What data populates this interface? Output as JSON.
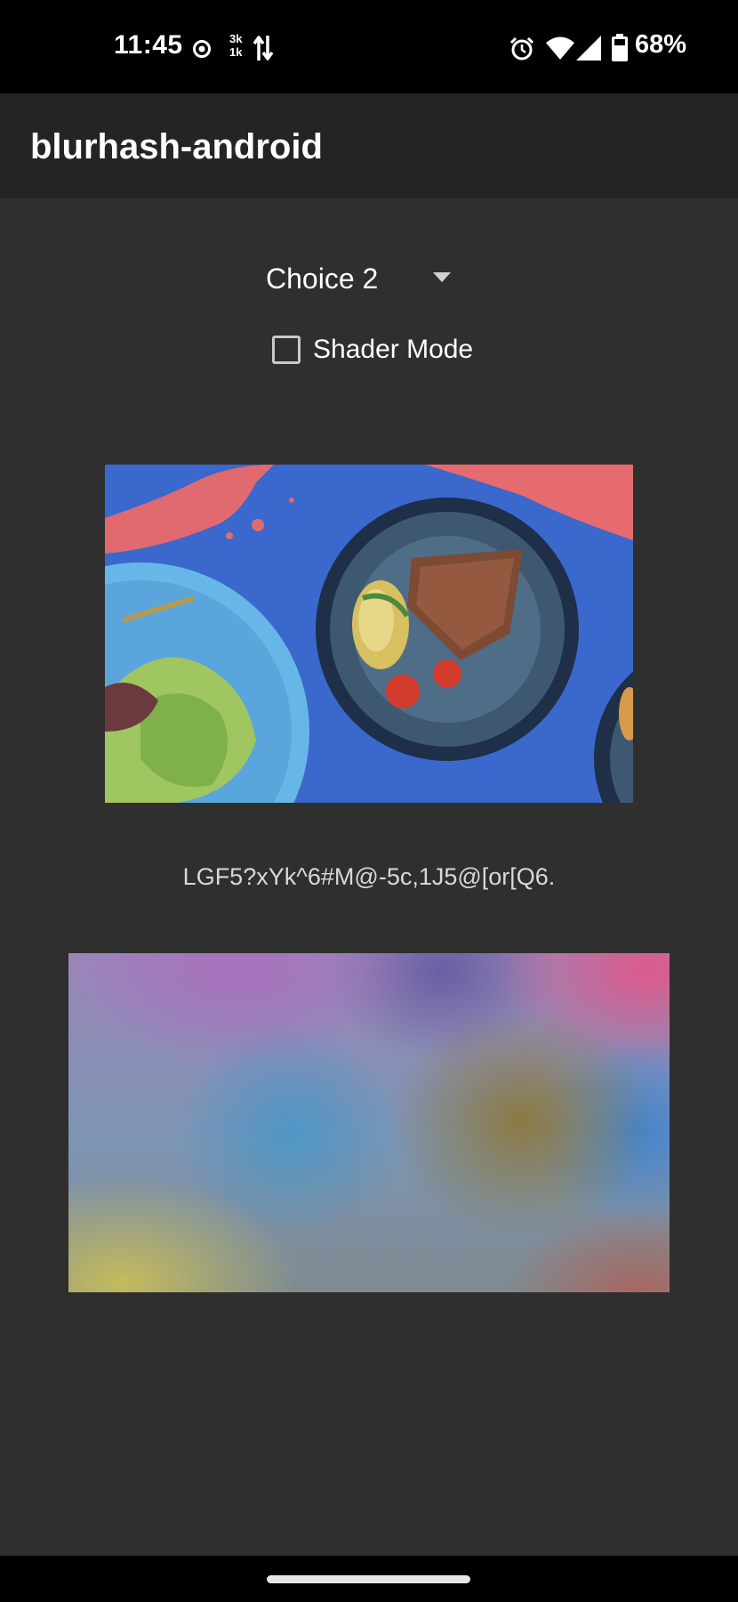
{
  "status_bar": {
    "time": "11:45",
    "net_up": "3k",
    "net_down": "1k",
    "battery_percent": "68%",
    "icons": [
      "record-icon",
      "data-transfer-icon",
      "alarm-icon",
      "wifi-icon",
      "cellular-signal-icon",
      "battery-icon"
    ]
  },
  "app_bar": {
    "title": "blurhash-android"
  },
  "controls": {
    "spinner_value": "Choice 2",
    "shader_mode_label": "Shader Mode",
    "shader_mode_checked": false
  },
  "content": {
    "blurhash": "LGF5?xYk^6#M@-5c,1J5@[or[Q6."
  },
  "colors": {
    "background": "#2f2f2f",
    "app_bar": "#242424",
    "status_bar": "#000000",
    "text": "#ffffff"
  }
}
